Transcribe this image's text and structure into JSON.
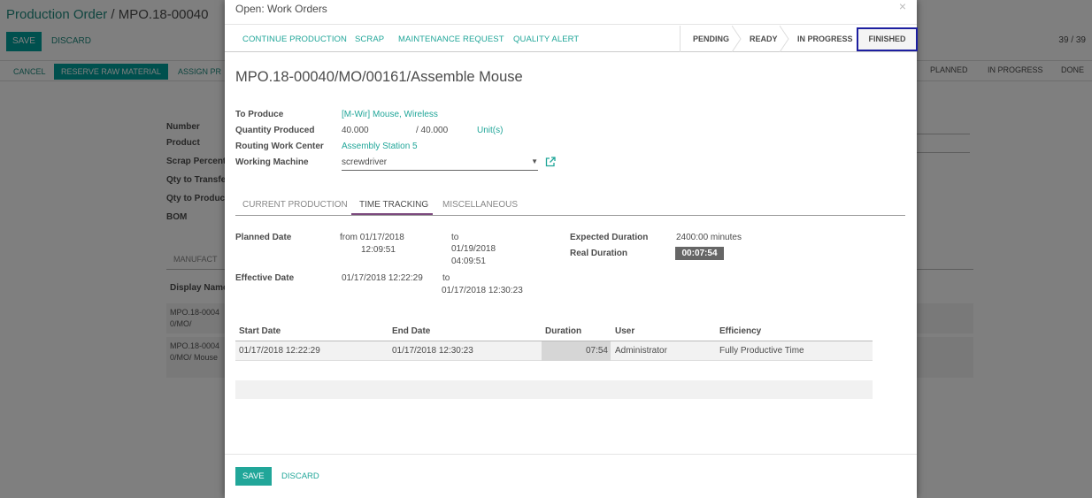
{
  "background": {
    "breadcrumb": {
      "parent": "Production Order",
      "separator": "/",
      "current": "MPO.18-00040"
    },
    "save_label": "SAVE",
    "discard_label": "DISCARD",
    "pager": "39 / 39",
    "status_buttons": [
      "CANCEL",
      "RESERVE RAW MATERIAL",
      "ASSIGN PR"
    ],
    "stages": [
      "PLANNED",
      "IN PROGRESS",
      "DONE"
    ],
    "field_labels": [
      "Number",
      "Product",
      "Scrap Percent",
      "Qty to Transfe",
      "Qty to Produc",
      "BOM"
    ],
    "section_label": "MANUFACT",
    "table_header": "Display Name",
    "rows": [
      "MPO.18-00040/MO/",
      "MPO.18-00040/MO/ Mouse"
    ]
  },
  "modal": {
    "title": "Open: Work Orders",
    "close_glyph": "×",
    "toolbar": {
      "continue_production": "CONTINUE PRODUCTION",
      "scrap": "SCRAP",
      "maintenance_request": "MAINTENANCE REQUEST",
      "quality_alert": "QUALITY ALERT"
    },
    "stages": {
      "pending": "PENDING",
      "ready": "READY",
      "in_progress": "IN PROGRESS",
      "finished": "FINISHED"
    },
    "doc_title": "MPO.18-00040/MO/00161/Assemble Mouse",
    "fields": {
      "to_produce_label": "To Produce",
      "to_produce_value": "[M-Wir] Mouse, Wireless",
      "qty_produced_label": "Quantity Produced",
      "qty_produced_value": "40.000",
      "qty_total": "/ 40.000",
      "qty_unit": "Unit(s)",
      "routing_label": "Routing Work Center",
      "routing_value": "Assembly Station 5",
      "machine_label": "Working Machine",
      "machine_value": "screwdriver"
    },
    "tabs": {
      "current_production": "CURRENT PRODUCTION",
      "time_tracking": "TIME TRACKING",
      "miscellaneous": "MISCELLANEOUS"
    },
    "time_tracking": {
      "planned_date_label": "Planned Date",
      "planned_from_line1": "from 01/17/2018",
      "planned_from_line2": "12:09:51",
      "planned_to_word": "to",
      "planned_to_line1": "01/19/2018",
      "planned_to_line2": "04:09:51",
      "effective_date_label": "Effective Date",
      "effective_from": "01/17/2018 12:22:29",
      "effective_to_word": "to",
      "effective_to": "01/17/2018 12:30:23",
      "expected_duration_label": "Expected Duration",
      "expected_duration_value": "2400:00 minutes",
      "real_duration_label": "Real Duration",
      "real_duration_value": "00:07:54"
    },
    "table": {
      "headers": [
        "Start Date",
        "End Date",
        "Duration",
        "User",
        "Efficiency"
      ],
      "rows": [
        [
          "01/17/2018 12:22:29",
          "01/17/2018 12:30:23",
          "07:54",
          "Administrator",
          "Fully Productive Time"
        ]
      ]
    },
    "footer": {
      "save": "SAVE",
      "discard": "DISCARD"
    }
  },
  "colors": {
    "accent": "#21a699",
    "primary_bg": "#00a09d",
    "tab_underline": "#7c4a7e",
    "highlight_border": "#1d1fa0"
  },
  "icons": {
    "external_link": "external-link-icon",
    "dropdown": "chevron-down-icon",
    "close": "close-icon"
  }
}
